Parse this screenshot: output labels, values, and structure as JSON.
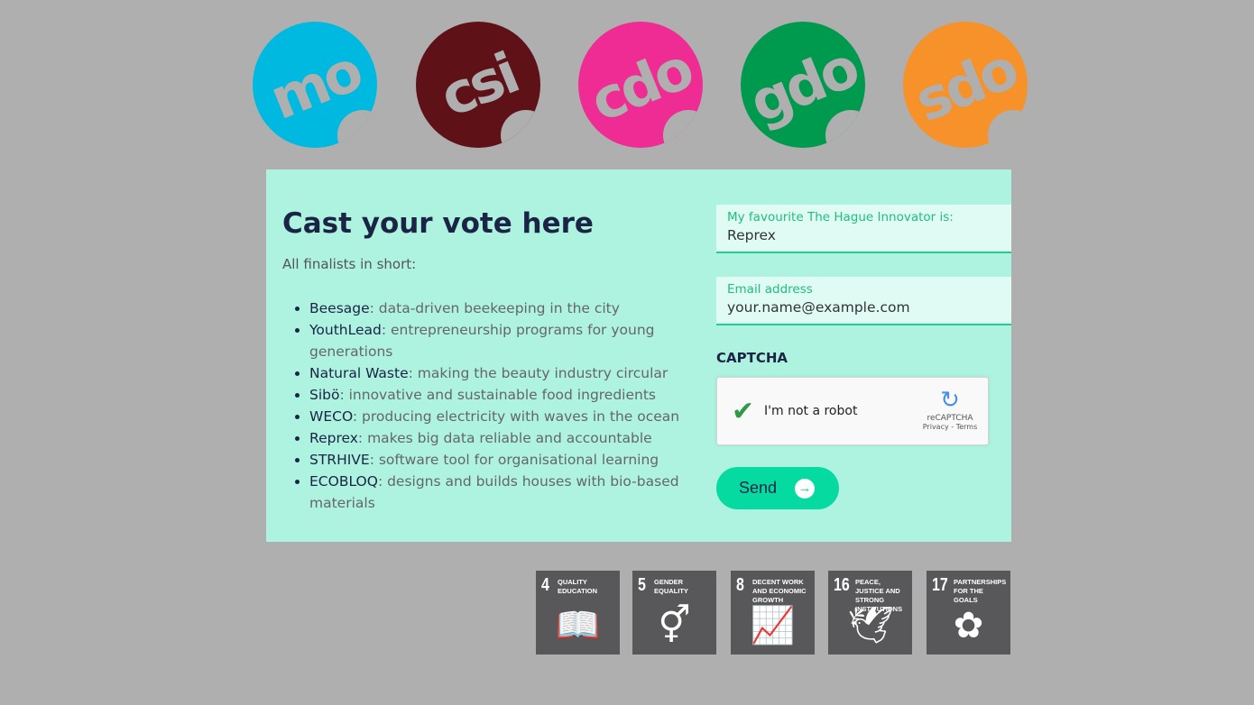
{
  "logos": [
    {
      "text": "mo",
      "color": "#00b9e0"
    },
    {
      "text": "csi",
      "color": "#5e1218"
    },
    {
      "text": "cdo",
      "color": "#ef2c93"
    },
    {
      "text": "gdo",
      "color": "#009a4f"
    },
    {
      "text": "sdo",
      "color": "#f7912a"
    }
  ],
  "vote": {
    "title": "Cast your vote here",
    "intro": "All finalists in short:",
    "finalists": [
      {
        "name": "Beesage",
        "desc": ": data-driven beekeeping in the city"
      },
      {
        "name": "YouthLead",
        "desc": ": entrepreneurship programs for young generations"
      },
      {
        "name": "Natural Waste",
        "desc": ": making the beauty industry circular"
      },
      {
        "name": "Sibö",
        "desc": ": innovative and sustainable food ingredients"
      },
      {
        "name": "WECO",
        "desc": ": producing electricity with waves in the ocean"
      },
      {
        "name": "Reprex",
        "desc": ": makes big data reliable and accountable"
      },
      {
        "name": "STRHIVE",
        "desc": ": software tool for organisational learning"
      },
      {
        "name": "ECOBLOQ",
        "desc": ": designs and builds houses with bio-based materials"
      }
    ]
  },
  "form": {
    "favourite_label": "My favourite The Hague Innovator is:",
    "favourite_value": "Reprex",
    "email_label": "Email address",
    "email_placeholder": "your.name@example.com",
    "captcha_title": "CAPTCHA",
    "captcha_label": "I'm not a robot",
    "captcha_brand": "reCAPTCHA",
    "captcha_links": "Privacy - Terms",
    "send_label": "Send"
  },
  "sdgs": [
    {
      "num": "4",
      "title": "QUALITY EDUCATION",
      "icon": "book-icon"
    },
    {
      "num": "5",
      "title": "GENDER EQUALITY",
      "icon": "gender-icon"
    },
    {
      "num": "8",
      "title": "DECENT WORK AND ECONOMIC GROWTH",
      "icon": "growth-chart-icon"
    },
    {
      "num": "16",
      "title": "PEACE, JUSTICE AND STRONG INSTITUTIONS",
      "icon": "dove-icon"
    },
    {
      "num": "17",
      "title": "PARTNERSHIPS FOR THE GOALS",
      "icon": "rings-icon"
    }
  ]
}
